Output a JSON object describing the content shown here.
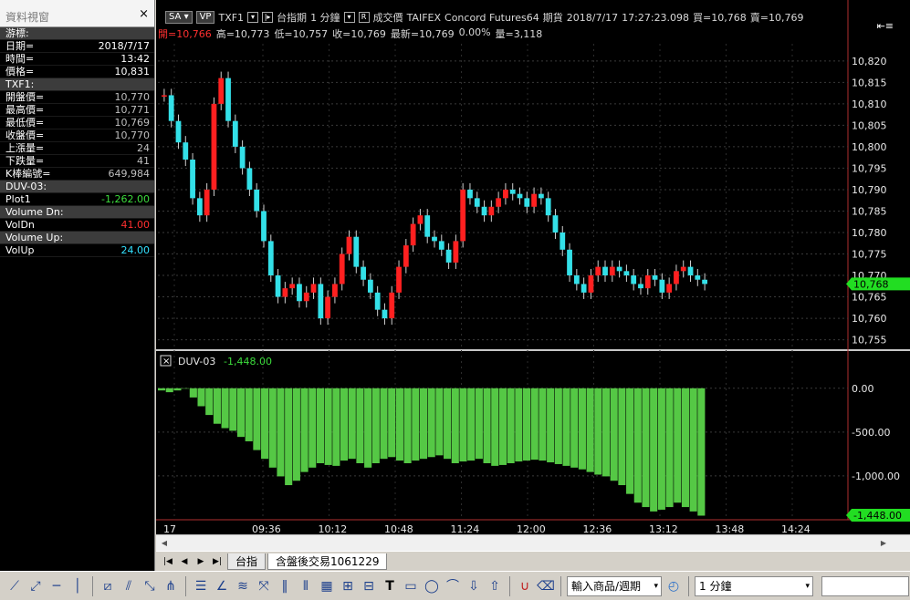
{
  "datawin": {
    "title": "資料視窗",
    "close": "×",
    "cursor_header": "游標:",
    "date_label": "日期=",
    "date_value": "2018/7/17",
    "time_label": "時間=",
    "time_value": "13:42",
    "price_label": "價格=",
    "price_value": "10,831",
    "txf_header": "TXF1:",
    "open_label": "開盤價=",
    "open_value": "10,770",
    "high_label": "最高價=",
    "high_value": "10,771",
    "low_label": "最低價=",
    "low_value": "10,769",
    "close_label": "收盤價=",
    "close_value": "10,770",
    "up_label": "上漲量=",
    "up_value": "24",
    "down_label": "下跌量=",
    "down_value": "41",
    "k_label": "K棒編號=",
    "k_value": "649,984",
    "duv_header": "DUV-03:",
    "plot1_label": "Plot1",
    "plot1_value": "-1,262.00",
    "vdn_header": "Volume Dn:",
    "voldn_label": "VolDn",
    "voldn_value": "41.00",
    "vup_header": "Volume Up:",
    "volup_label": "VolUp",
    "volup_value": "24.00"
  },
  "header": {
    "sa": "SA",
    "sa_dd": "▾",
    "vp": "VP",
    "symbol": "TXF1",
    "index": "台指期",
    "period": "1 分鐘",
    "r_btn": "R",
    "trade_price": "成交價",
    "exchange": "TAIFEX",
    "source": "Concord Futures64",
    "kind": "期貨",
    "datetime": "2018/7/17",
    "clock": "17:27:23.098",
    "buy": "買=10,768",
    "sell": "賣=10,769",
    "open": "開=10,766",
    "high": "高=10,773",
    "low": "低=10,757",
    "close": "收=10,769",
    "last": "最新=10,769",
    "pct": "0.00%",
    "volume": "量=3,118",
    "menu_icon": "⇤≡"
  },
  "price_axis": [
    "10,820",
    "10,815",
    "10,810",
    "10,805",
    "10,800",
    "10,795",
    "10,790",
    "10,785",
    "10,780",
    "10,775",
    "10,770",
    "10,765",
    "10,760",
    "10,755"
  ],
  "price_marker": "10,768",
  "indicator": {
    "name": "DUV-03",
    "value": "-1,448.00",
    "axis": [
      "0.00",
      "-500.00",
      "-1,000.00"
    ],
    "marker": "-1,448.00"
  },
  "time_axis": [
    "17",
    "09:36",
    "10:12",
    "10:48",
    "11:24",
    "12:00",
    "12:36",
    "13:12",
    "13:48",
    "14:24"
  ],
  "tabs": {
    "nav": [
      "|◀",
      "◀",
      "▶",
      "▶|"
    ],
    "tab1": "台指",
    "tab2": "含盤後交易1061229"
  },
  "toolbar": {
    "product_select": "輸入商品/週期",
    "period_select": "1 分鐘",
    "dd": "▾",
    "text_tool": "T"
  },
  "chart_data": [
    {
      "type": "candlestick",
      "series": [
        {
          "name": "TXF1"
        }
      ],
      "y_axis_ticks": [
        10820,
        10815,
        10810,
        10805,
        10800,
        10795,
        10790,
        10785,
        10780,
        10775,
        10770,
        10765,
        10760,
        10755
      ],
      "ylim": [
        10753,
        10824
      ],
      "approx_closes": [
        10812,
        10806,
        10801,
        10797,
        10788,
        10784,
        10790,
        10810,
        10816,
        10806,
        10800,
        10795,
        10790,
        10785,
        10778,
        10770,
        10765,
        10767,
        10768,
        10764,
        10766,
        10768,
        10760,
        10765,
        10768,
        10775,
        10779,
        10772,
        10769,
        10766,
        10762,
        10760,
        10766,
        10772,
        10777,
        10782,
        10784,
        10779,
        10778,
        10776,
        10773,
        10778,
        10790,
        10788,
        10786,
        10784,
        10786,
        10788,
        10790,
        10789,
        10788,
        10786,
        10789,
        10788,
        10784,
        10780,
        10776,
        10770,
        10768,
        10766,
        10770,
        10772,
        10770,
        10772,
        10771,
        10770,
        10768,
        10767,
        10770,
        10769,
        10766,
        10768,
        10771,
        10772,
        10770,
        10769,
        10768
      ]
    },
    {
      "type": "bar",
      "series": [
        {
          "name": "DUV-03"
        }
      ],
      "y_axis_ticks": [
        0,
        -500,
        -1000
      ],
      "ylim": [
        -1500,
        60
      ],
      "approx_values": [
        -20,
        -40,
        -20,
        0,
        -100,
        -200,
        -300,
        -400,
        -450,
        -480,
        -550,
        -600,
        -700,
        -800,
        -900,
        -1000,
        -1100,
        -1050,
        -950,
        -900,
        -850,
        -870,
        -880,
        -820,
        -800,
        -850,
        -900,
        -850,
        -800,
        -780,
        -820,
        -850,
        -820,
        -800,
        -780,
        -760,
        -800,
        -850,
        -830,
        -820,
        -800,
        -850,
        -880,
        -870,
        -850,
        -830,
        -820,
        -810,
        -820,
        -840,
        -860,
        -880,
        -900,
        -920,
        -950,
        -980,
        -1000,
        -1050,
        -1100,
        -1200,
        -1300,
        -1350,
        -1400,
        -1380,
        -1350,
        -1300,
        -1350,
        -1400,
        -1448
      ]
    }
  ]
}
